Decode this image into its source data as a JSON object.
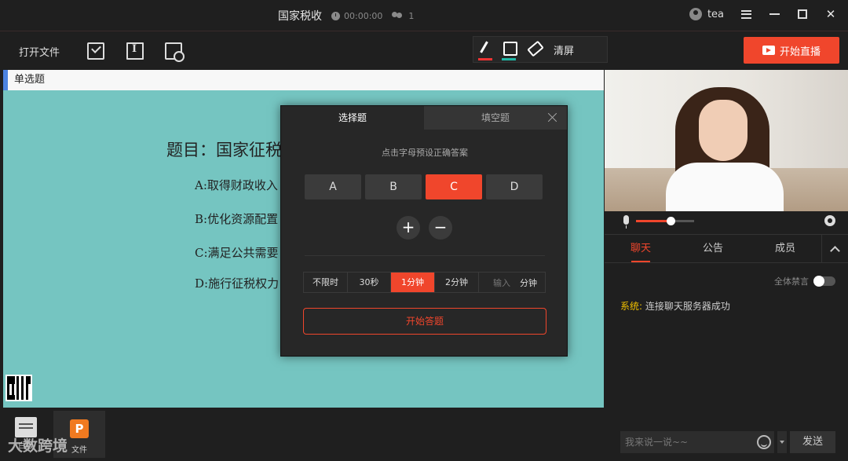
{
  "window": {
    "title": "国家税收",
    "duration": "00:00:00",
    "viewer_count": "1",
    "username": "tea"
  },
  "toolbar": {
    "open_file": "打开文件",
    "clear_screen": "清屏",
    "go_live": "开始直播"
  },
  "slide": {
    "header": "单选题",
    "question": "题目：国家征税",
    "options": [
      "A:取得财政收入",
      "B:优化资源配置",
      "C:满足公共需要",
      "D:施行征税权力"
    ]
  },
  "thumbnails": {
    "whiteboard_label": "白板",
    "ppt_label": "文件"
  },
  "watermark": "大数跨境",
  "dialog": {
    "tabs": [
      "选择题",
      "填空题"
    ],
    "active_tab": "选择题",
    "hint": "点击字母预设正确答案",
    "answers": [
      "A",
      "B",
      "C",
      "D"
    ],
    "selected_answer": "C",
    "plus": "+",
    "minus": "−",
    "timers": [
      "不限时",
      "30秒",
      "1分钟",
      "2分钟"
    ],
    "selected_timer": "1分钟",
    "custom_placeholder": "输入",
    "custom_unit": "分钟",
    "start_label": "开始答题"
  },
  "controls": {
    "volume": 0.6
  },
  "chat": {
    "tabs": [
      "聊天",
      "公告",
      "成员"
    ],
    "active_tab": "聊天",
    "mute_all": "全体禁言",
    "system_label": "系统:",
    "system_message": "连接聊天服务器成功",
    "input_placeholder": "我来说一说~~",
    "send": "发送"
  },
  "colors": {
    "accent": "#f0462c",
    "slide_bg": "#75c5c1"
  }
}
